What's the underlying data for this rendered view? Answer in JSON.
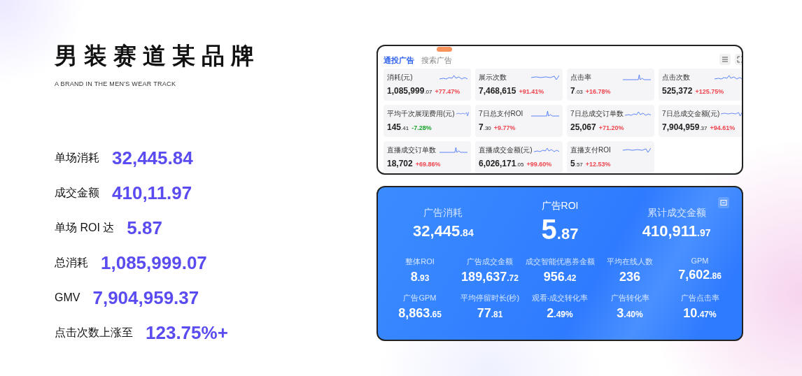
{
  "title": "男装赛道某品牌",
  "subtitle": "A BRAND IN THE MEN'S WEAR TRACK",
  "stats": [
    {
      "label": "单场消耗",
      "value": "32,445.84"
    },
    {
      "label": "成交金额",
      "value": "410,11.97"
    },
    {
      "label": "单场 ROI 达",
      "value": "5.87"
    },
    {
      "label": "总消耗",
      "value": "1,085,999.07"
    },
    {
      "label": "GMV",
      "value": "7,904,959.37"
    },
    {
      "label": "点击次数上涨至",
      "value": "123.75%+"
    }
  ],
  "ad_panel": {
    "tabs": [
      {
        "label": "通投广告",
        "selected": true,
        "badge": false
      },
      {
        "label": "搜索广告",
        "selected": false,
        "badge": true
      }
    ],
    "metrics": [
      {
        "label": "消耗(元)",
        "int": "1,085,999",
        "dec": ".07",
        "change": "+77.47%",
        "color": "#f0454e"
      },
      {
        "label": "展示次数",
        "int": "7,468,615",
        "change": "+91.41%",
        "color": "#f0454e"
      },
      {
        "label": "点击率",
        "int": "7",
        "dec": ".03",
        "change": "+16.78%",
        "color": "#f0454e"
      },
      {
        "label": "点击次数",
        "int": "525,372",
        "change": "+125.75%",
        "color": "#f0454e"
      },
      {
        "label": "平均千次展现费用(元)",
        "int": "145",
        "dec": ".41",
        "change": "-7.28%",
        "color": "#1aa32a"
      },
      {
        "label": "7日总支付ROI",
        "int": "7",
        "dec": ".30",
        "change": "+9.77%",
        "color": "#f0454e"
      },
      {
        "label": "7日总成交订单数",
        "int": "25,067",
        "change": "+71.20%",
        "color": "#f0454e"
      },
      {
        "label": "7日总成交金额(元)",
        "int": "7,904,959",
        "dec": ".37",
        "change": "+94.61%",
        "color": "#f0454e"
      },
      {
        "label": "直播成交订单数",
        "int": "18,702",
        "change": "+69.86%",
        "color": "#f0454e"
      },
      {
        "label": "直播成交金额(元)",
        "int": "6,026,171",
        "dec": ".05",
        "change": "+99.60%",
        "color": "#f0454e"
      },
      {
        "label": "直播支付ROI",
        "int": "5",
        "dec": ".57",
        "change": "+12.53%",
        "color": "#f0454e"
      }
    ]
  },
  "live_panel": {
    "main": [
      {
        "label": "广告消耗",
        "int": "32,445",
        "dec": ".84",
        "kind": "standard"
      },
      {
        "label": "广告ROI",
        "int": "5",
        "dec": ".87",
        "kind": "hero"
      },
      {
        "label": "累计成交金额",
        "int": "410,911",
        "dec": ".97",
        "kind": "standard"
      }
    ],
    "rows": [
      [
        {
          "label": "整体ROI",
          "int": "8",
          "dec": ".93"
        },
        {
          "label": "广告成交金额",
          "int": "189,637",
          "dec": ".72"
        },
        {
          "label": "成交智能优惠券金额",
          "int": "956",
          "dec": ".42"
        },
        {
          "label": "平均在线人数",
          "int": "236"
        },
        {
          "label": "GPM",
          "int": "7,602",
          "dec": ".86"
        }
      ],
      [
        {
          "label": "广告GPM",
          "int": "8,863",
          "dec": ".65"
        },
        {
          "label": "平均停留时长(秒)",
          "int": "77",
          "dec": ".81"
        },
        {
          "label": "观看-成交转化率",
          "int": "2",
          "dec": ".49%"
        },
        {
          "label": "广告转化率",
          "int": "3",
          "dec": ".40%"
        },
        {
          "label": "广告点击率",
          "int": "10",
          "dec": ".47%"
        }
      ]
    ]
  }
}
